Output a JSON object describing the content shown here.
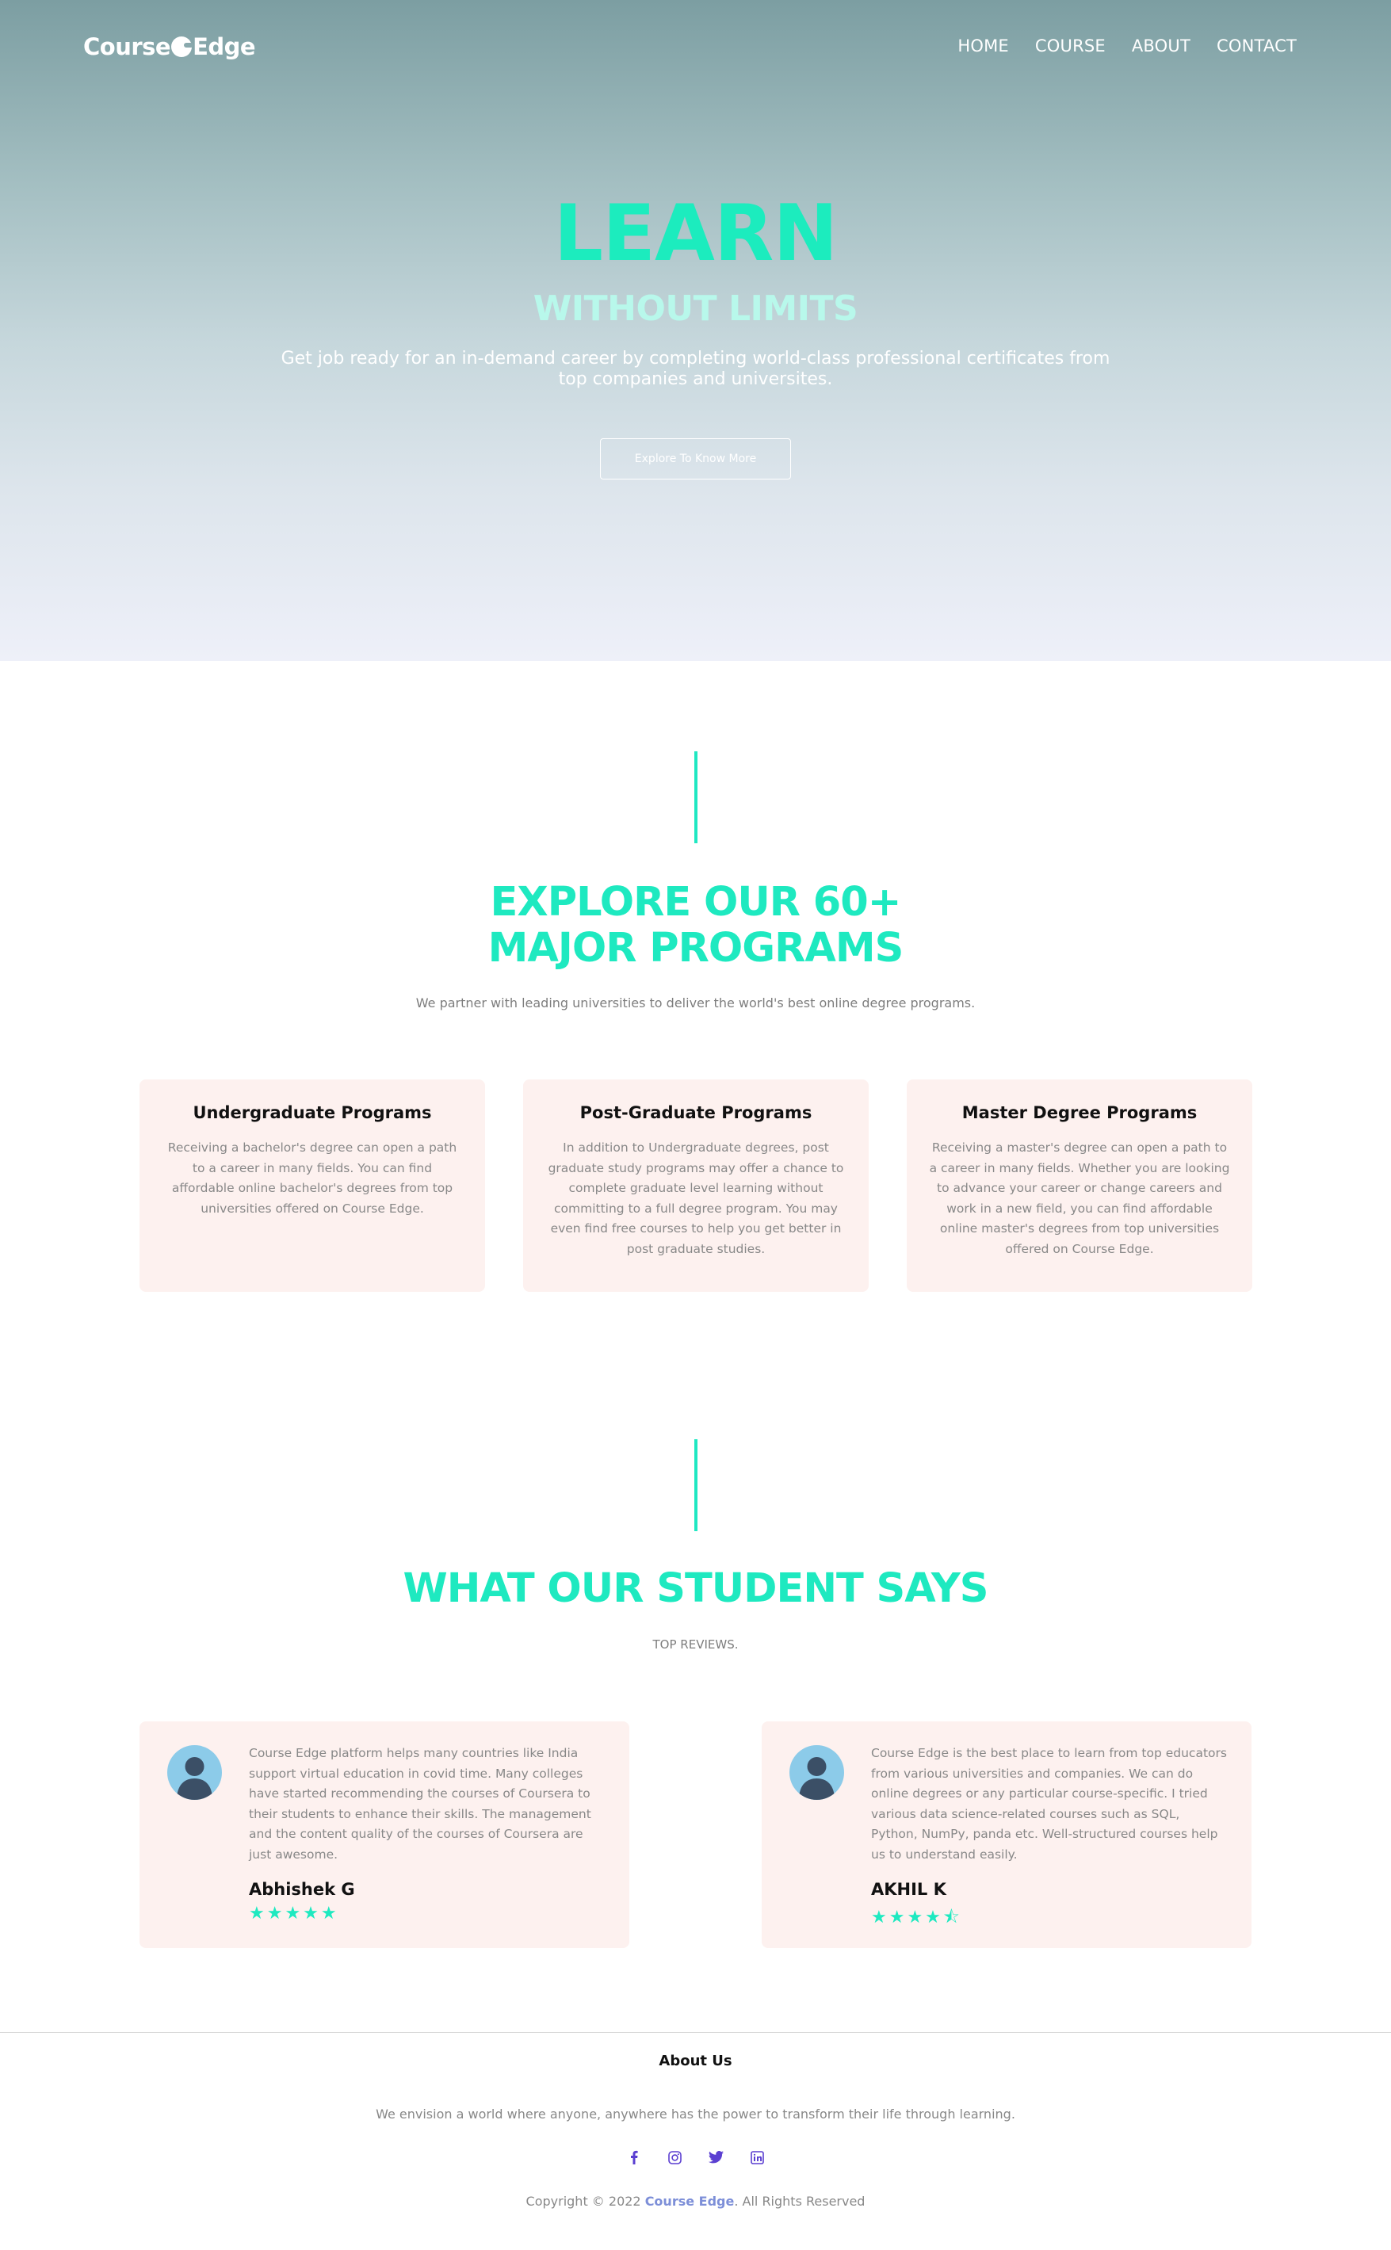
{
  "nav": {
    "logo_part1": "Course",
    "logo_part2": "Edge",
    "links": [
      "HOME",
      "COURSE",
      "ABOUT",
      "CONTACT"
    ]
  },
  "hero": {
    "title": "LEARN",
    "subtitle": "WITHOUT LIMITS",
    "description": "Get job ready for an in-demand career by completing world-class professional certificates from top companies and universites.",
    "button_label": "Explore To Know More"
  },
  "programs": {
    "title_line1": "EXPLORE OUR 60+",
    "title_line2": "MAJOR PROGRAMS",
    "subtitle": "We partner with leading universities to deliver the world's best online degree programs.",
    "cards": [
      {
        "title": "Undergraduate Programs",
        "text": "Receiving a bachelor's degree can open a path to a career in many fields. You can find affordable online bachelor's degrees from top universities offered on Course Edge."
      },
      {
        "title": "Post-Graduate Programs",
        "text": "In addition to Undergraduate degrees, post graduate study programs may offer a chance to complete graduate level learning without committing to a full degree program. You may even find free courses to help you get better in post graduate studies."
      },
      {
        "title": "Master Degree Programs",
        "text": "Receiving a master's degree can open a path to a career in many fields. Whether you are looking to advance your career or change careers and work in a new field, you can find affordable online master's degrees from top universities offered on Course Edge."
      }
    ]
  },
  "reviews": {
    "title": "WHAT OUR STUDENT SAYS",
    "subtitle": "TOP REVIEWS.",
    "items": [
      {
        "text": "Course Edge platform helps many countries like India support virtual education in covid time. Many colleges have started recommending the courses of Coursera to their students to enhance their skills. The management and the content quality of the courses of Coursera are just awesome.",
        "name": "Abhishek G",
        "stars": "★★★★★",
        "rating": 5
      },
      {
        "text": "Course Edge is the best place to learn from top educators from various universities and companies. We can do online degrees or any particular course-specific. I tried various data science-related courses such as SQL, Python, NumPy, panda etc. Well-structured courses help us to understand easily.",
        "name": "AKHIL K",
        "stars": "★★★★⯪",
        "rating": 4.5
      }
    ]
  },
  "footer": {
    "title": "About Us",
    "description": "We envision a world where anyone, anywhere has the power to transform their life through learning.",
    "social_icons": [
      "facebook-icon",
      "instagram-icon",
      "twitter-icon",
      "linkedin-icon"
    ],
    "copyright_prefix": "Copyright © 2022 ",
    "copyright_brand": "Course Edge",
    "copyright_suffix": ". All Rights Reserved"
  },
  "colors": {
    "accent": "#1ee9c0",
    "card_bg": "#fdf1ef",
    "social": "#5b3fd1",
    "brand_link": "#7d8fd8"
  }
}
